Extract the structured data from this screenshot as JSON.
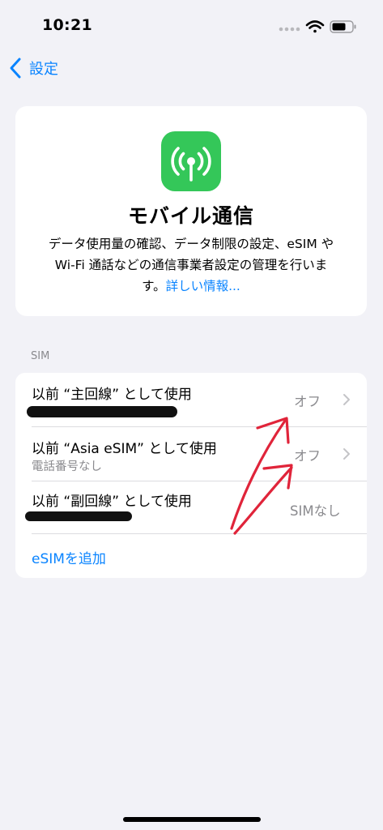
{
  "status_bar": {
    "time": "10:21"
  },
  "nav": {
    "back_label": "設定"
  },
  "hero": {
    "title": "モバイル通信",
    "description_line1": "データ使用量の確認、データ制限の設定、eSIM や",
    "description_line2": "Wi-Fi 通話などの通信事業者設定の管理を行いま",
    "description_line3": "す。",
    "link_label": "詳しい情報..."
  },
  "sim_section": {
    "header": "SIM",
    "rows": [
      {
        "title": "以前 “主回線” として使用",
        "value": "オフ"
      },
      {
        "title": "以前 “Asia eSIM” として使用",
        "subtitle": "電話番号なし",
        "value": "オフ"
      },
      {
        "title": "以前 “副回線” として使用",
        "value": "SIMなし"
      }
    ],
    "add_label": "eSIMを追加"
  },
  "colors": {
    "accent": "#0a84ff",
    "app_icon": "#34c759",
    "annotation": "#e0243a"
  }
}
